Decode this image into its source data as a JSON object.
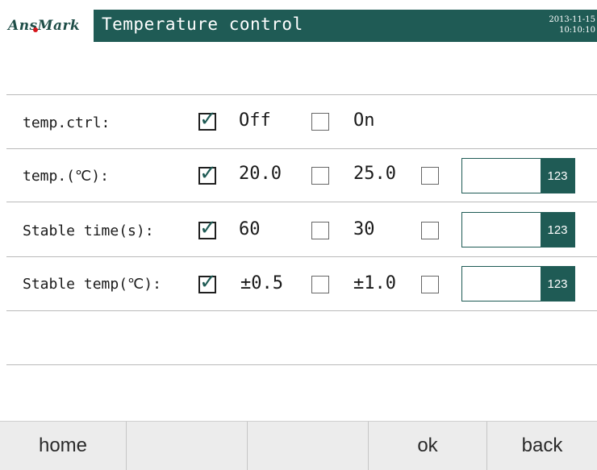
{
  "header": {
    "logo_text": "AnsMark",
    "title": "Temperature control",
    "date": "2013-11-15",
    "time": "10:10:10"
  },
  "rows": [
    {
      "label": "temp.ctrl:",
      "opt1_value": "Off",
      "opt1_checked": true,
      "opt2_value": "On",
      "opt2_checked": false,
      "has_custom": false
    },
    {
      "label": "temp.(℃):",
      "opt1_value": "20.0",
      "opt1_checked": true,
      "opt2_value": "25.0",
      "opt2_checked": false,
      "has_custom": true,
      "custom_value": "",
      "keypad_label": "123"
    },
    {
      "label": "Stable time(s):",
      "opt1_value": "60",
      "opt1_checked": true,
      "opt2_value": "30",
      "opt2_checked": false,
      "has_custom": true,
      "custom_value": "",
      "keypad_label": "123"
    },
    {
      "label": "Stable temp(℃):",
      "opt1_value": "±0.5",
      "opt1_checked": true,
      "opt2_value": "±1.0",
      "opt2_checked": false,
      "has_custom": true,
      "custom_value": "",
      "keypad_label": "123"
    }
  ],
  "footer": {
    "buttons": [
      "home",
      "",
      "",
      "ok",
      "back"
    ]
  },
  "colors": {
    "accent": "#1f5b55",
    "logo_dot": "#d6161b"
  }
}
